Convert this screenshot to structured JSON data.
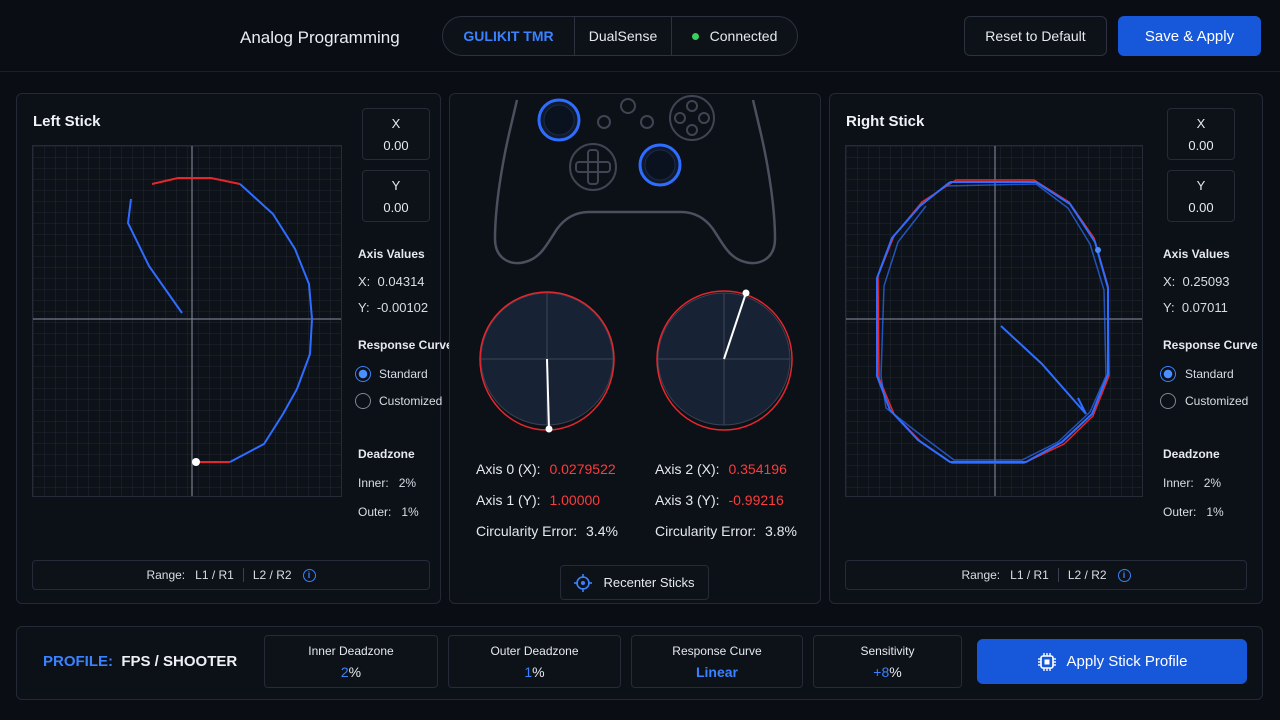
{
  "header": {
    "title": "Analog Programming",
    "device": {
      "brand": "GULIKIT TMR",
      "model": "DualSense",
      "status": "Connected"
    },
    "reset_label": "Reset to Default",
    "save_label": "Save & Apply"
  },
  "left_stick": {
    "title": "Left Stick",
    "x_label": "X",
    "x_value": "0.00",
    "y_label": "Y",
    "y_value": "0.00",
    "axis_values_label": "Axis Values",
    "axis_x_label": "X:",
    "axis_x_value": "0.04314",
    "axis_y_label": "Y:",
    "axis_y_value": "-0.00102",
    "response_curve_label": "Response Curve",
    "option_standard": "Standard",
    "option_customized": "Customized",
    "deadzone_label": "Deadzone",
    "inner_label": "Inner:",
    "inner_value": "2%",
    "outer_label": "Outer:",
    "outer_value": "1%",
    "range_label": "Range:",
    "range_a": "L1 / R1",
    "range_b": "L2 / R2"
  },
  "right_stick": {
    "title": "Right Stick",
    "x_label": "X",
    "x_value": "0.00",
    "y_label": "Y",
    "y_value": "0.00",
    "axis_values_label": "Axis Values",
    "axis_x_label": "X:",
    "axis_x_value": "0.25093",
    "axis_y_label": "Y:",
    "axis_y_value": "0.07011",
    "response_curve_label": "Response Curve",
    "option_standard": "Standard",
    "option_customized": "Customized",
    "deadzone_label": "Deadzone",
    "inner_label": "Inner:",
    "inner_value": "2%",
    "outer_label": "Outer:",
    "outer_value": "1%",
    "range_label": "Range:",
    "range_a": "L1 / R1",
    "range_b": "L2 / R2"
  },
  "center": {
    "axis0_label": "Axis 0 (X):",
    "axis0_value": "0.0279522",
    "axis1_label": "Axis 1 (Y):",
    "axis1_value": "1.00000",
    "circ_left_label": "Circularity Error:",
    "circ_left_value": "3.4%",
    "axis2_label": "Axis 2 (X):",
    "axis2_value": "0.354196",
    "axis3_label": "Axis 3 (Y):",
    "axis3_value": "-0.99216",
    "circ_right_label": "Circularity Error:",
    "circ_right_value": "3.8%",
    "recenter_label": "Recenter Sticks"
  },
  "footer": {
    "profile_label": "PROFILE:",
    "profile_name": "FPS / SHOOTER",
    "inner_deadzone_label": "Inner Deadzone",
    "inner_deadzone_num": "2",
    "inner_deadzone_unit": "%",
    "outer_deadzone_label": "Outer Deadzone",
    "outer_deadzone_num": "1",
    "outer_deadzone_unit": "%",
    "response_curve_label": "Response Curve",
    "response_curve_value": "Linear",
    "sensitivity_label": "Sensitivity",
    "sensitivity_num": "+8",
    "sensitivity_unit": "%",
    "apply_label": "Apply Stick Profile"
  },
  "colors": {
    "accent": "#3a82ff",
    "primary_button": "#1757d9",
    "error_red": "#ff3b3b",
    "status_green": "#37d05a",
    "background": "#0a0d13"
  }
}
